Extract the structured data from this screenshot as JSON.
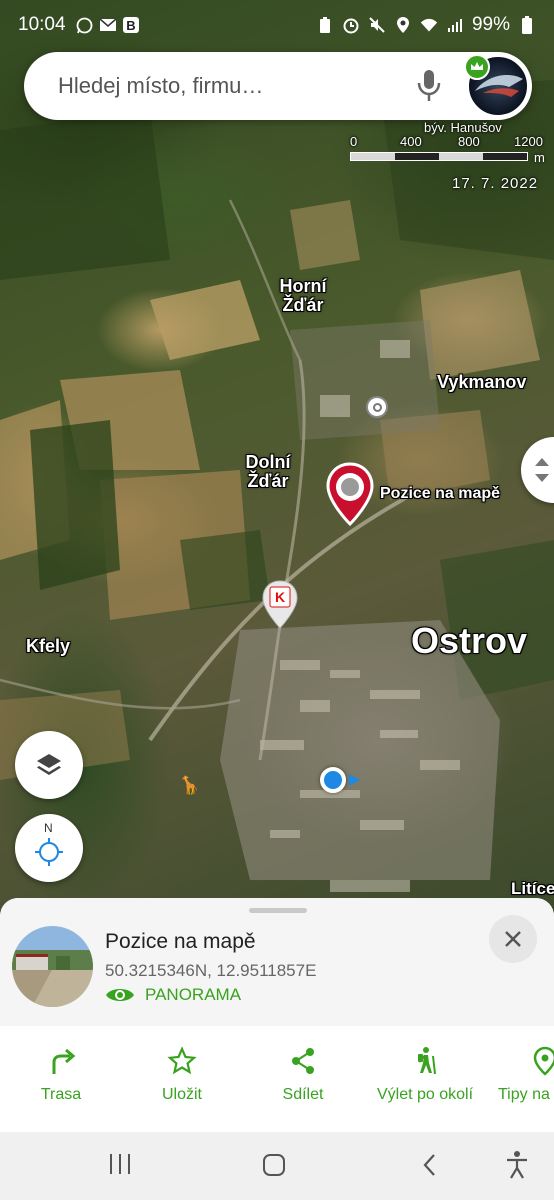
{
  "status_bar": {
    "time": "10:04",
    "battery": "99%"
  },
  "search": {
    "placeholder": "Hledej místo, firmu…"
  },
  "scale": {
    "locality": "býv. Hanušov",
    "ticks": [
      "0",
      "400",
      "800",
      "1200"
    ],
    "unit": "m",
    "imagery_date": "17. 7. 2022"
  },
  "map": {
    "labels": {
      "horni_zdar": "Horní Žďár",
      "vykmanov": "Vykmanov",
      "dolni_zdar": "Dolní Žďár",
      "pin_label": "Pozice na mapě",
      "kfely": "Kfely",
      "ostrov": "Ostrov",
      "litice": "Litíce"
    },
    "compass_letter": "N",
    "store_logo": "Kaufland"
  },
  "detail": {
    "title": "Pozice na mapě",
    "coordinates": "50.3215346N, 12.9511857E",
    "panorama_label": "PANORAMA"
  },
  "actions": [
    {
      "label": "Trasa",
      "icon": "route-icon"
    },
    {
      "label": "Uložit",
      "icon": "star-icon"
    },
    {
      "label": "Sdílet",
      "icon": "share-icon"
    },
    {
      "label": "Výlet po okolí",
      "icon": "hiker-icon"
    },
    {
      "label": "Tipy na",
      "icon": "pin-icon"
    }
  ],
  "colors": {
    "accent_green": "#39a320",
    "pin_red": "#c8102e",
    "location_blue": "#1e88e5"
  }
}
